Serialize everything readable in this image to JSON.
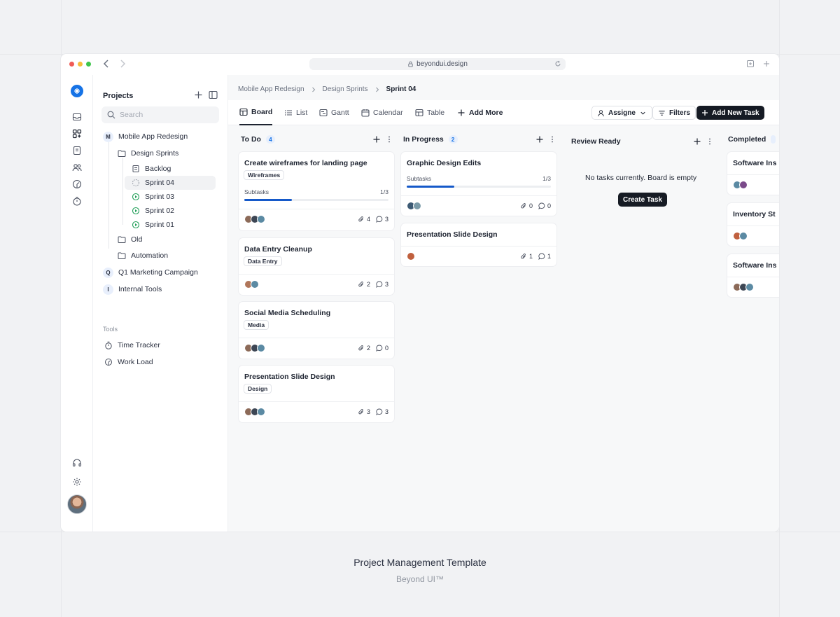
{
  "browser": {
    "url": "beyondui.design"
  },
  "sidebar": {
    "title": "Projects",
    "search_placeholder": "Search",
    "projects": [
      {
        "badge": "M",
        "label": "Mobile App Redesign"
      },
      {
        "label": "Design Sprints"
      },
      {
        "label": "Backlog"
      },
      {
        "label": "Sprint 04"
      },
      {
        "label": "Sprint 03"
      },
      {
        "label": "Sprint 02"
      },
      {
        "label": "Sprint 01"
      },
      {
        "label": "Old"
      },
      {
        "label": "Automation"
      },
      {
        "badge": "Q",
        "label": "Q1 Marketing Campaign"
      },
      {
        "badge": "I",
        "label": "Internal Tools"
      }
    ],
    "tools_label": "Tools",
    "tools": [
      {
        "label": "Time Tracker"
      },
      {
        "label": "Work Load"
      }
    ]
  },
  "breadcrumb": [
    "Mobile App Redesign",
    "Design Sprints",
    "Sprint 04"
  ],
  "view_tabs": [
    {
      "label": "Board",
      "icon": "board-icon"
    },
    {
      "label": "List",
      "icon": "list-icon"
    },
    {
      "label": "Gantt",
      "icon": "gantt-icon"
    },
    {
      "label": "Calendar",
      "icon": "calendar-icon"
    },
    {
      "label": "Table",
      "icon": "table-icon"
    },
    {
      "label": "Add More",
      "icon": "plus-icon"
    }
  ],
  "toolbar": {
    "assignee_label": "Assigne",
    "filters_label": "Filters",
    "add_task_label": "Add New Task"
  },
  "columns": [
    {
      "title": "To Do",
      "count": "4",
      "cards": [
        {
          "title": "Create wireframes for landing page",
          "tag": "Wireframes",
          "subtasks_label": "Subtasks",
          "subtasks": "1/3",
          "progress": 0.33,
          "attachments": "4",
          "comments": "3"
        },
        {
          "title": "Data Entry Cleanup",
          "tag": "Data Entry",
          "attachments": "2",
          "comments": "3"
        },
        {
          "title": "Social Media Scheduling",
          "tag": "Media",
          "attachments": "2",
          "comments": "0"
        },
        {
          "title": "Presentation Slide Design",
          "tag": "Design",
          "attachments": "3",
          "comments": "3"
        }
      ]
    },
    {
      "title": "In Progress",
      "count": "2",
      "cards": [
        {
          "title": "Graphic Design Edits",
          "subtasks_label": "Subtasks",
          "subtasks": "1/3",
          "progress": 0.33,
          "attachments": "0",
          "comments": "0"
        },
        {
          "title": "Presentation Slide Design",
          "attachments": "1",
          "comments": "1"
        }
      ]
    },
    {
      "title": "Review Ready",
      "empty_text": "No tasks currently. Board is empty",
      "create_label": "Create Task"
    },
    {
      "title": "Completed",
      "cards": [
        {
          "title": "Software Ins"
        },
        {
          "title": "Inventory St"
        },
        {
          "title": "Software Ins"
        }
      ]
    }
  ],
  "footer": {
    "title": "Project Management Template",
    "subtitle": "Beyond UI™"
  },
  "colors": {
    "accent": "#1673e6",
    "progress": "#1559c9",
    "dark_button": "#161b24"
  }
}
